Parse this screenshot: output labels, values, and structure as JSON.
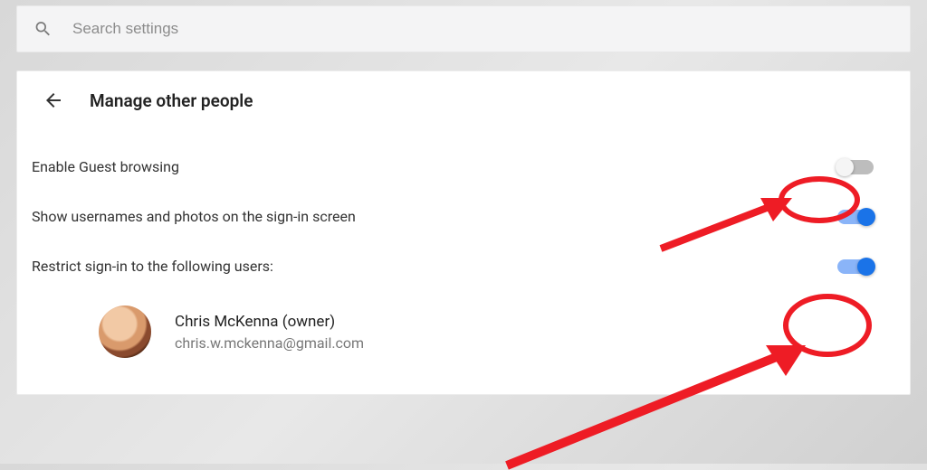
{
  "search": {
    "placeholder": "Search settings"
  },
  "page": {
    "title": "Manage other people"
  },
  "settings": {
    "guestBrowsing": {
      "label": "Enable Guest browsing",
      "enabled": false
    },
    "showUsernames": {
      "label": "Show usernames and photos on the sign-in screen",
      "enabled": true
    },
    "restrictSignIn": {
      "label": "Restrict sign-in to the following users:",
      "enabled": true
    }
  },
  "user": {
    "name": "Chris McKenna (owner)",
    "email": "chris.w.mckenna@gmail.com"
  },
  "colors": {
    "accent": "#1a73e8",
    "annotation": "#ee1c25"
  }
}
